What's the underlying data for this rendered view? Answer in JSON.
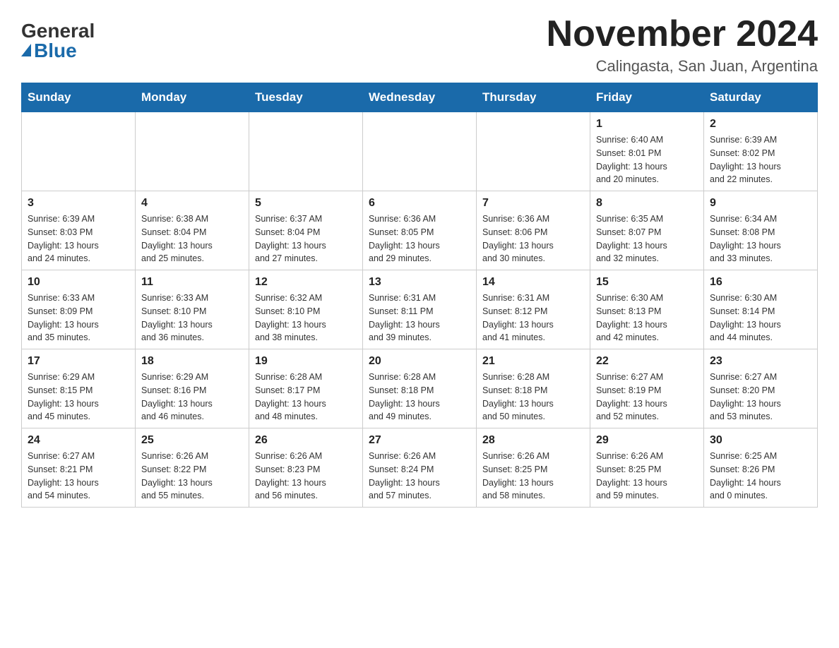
{
  "logo": {
    "general": "General",
    "blue": "Blue"
  },
  "title": "November 2024",
  "subtitle": "Calingasta, San Juan, Argentina",
  "days_of_week": [
    "Sunday",
    "Monday",
    "Tuesday",
    "Wednesday",
    "Thursday",
    "Friday",
    "Saturday"
  ],
  "weeks": [
    [
      {
        "day": "",
        "info": ""
      },
      {
        "day": "",
        "info": ""
      },
      {
        "day": "",
        "info": ""
      },
      {
        "day": "",
        "info": ""
      },
      {
        "day": "",
        "info": ""
      },
      {
        "day": "1",
        "info": "Sunrise: 6:40 AM\nSunset: 8:01 PM\nDaylight: 13 hours\nand 20 minutes."
      },
      {
        "day": "2",
        "info": "Sunrise: 6:39 AM\nSunset: 8:02 PM\nDaylight: 13 hours\nand 22 minutes."
      }
    ],
    [
      {
        "day": "3",
        "info": "Sunrise: 6:39 AM\nSunset: 8:03 PM\nDaylight: 13 hours\nand 24 minutes."
      },
      {
        "day": "4",
        "info": "Sunrise: 6:38 AM\nSunset: 8:04 PM\nDaylight: 13 hours\nand 25 minutes."
      },
      {
        "day": "5",
        "info": "Sunrise: 6:37 AM\nSunset: 8:04 PM\nDaylight: 13 hours\nand 27 minutes."
      },
      {
        "day": "6",
        "info": "Sunrise: 6:36 AM\nSunset: 8:05 PM\nDaylight: 13 hours\nand 29 minutes."
      },
      {
        "day": "7",
        "info": "Sunrise: 6:36 AM\nSunset: 8:06 PM\nDaylight: 13 hours\nand 30 minutes."
      },
      {
        "day": "8",
        "info": "Sunrise: 6:35 AM\nSunset: 8:07 PM\nDaylight: 13 hours\nand 32 minutes."
      },
      {
        "day": "9",
        "info": "Sunrise: 6:34 AM\nSunset: 8:08 PM\nDaylight: 13 hours\nand 33 minutes."
      }
    ],
    [
      {
        "day": "10",
        "info": "Sunrise: 6:33 AM\nSunset: 8:09 PM\nDaylight: 13 hours\nand 35 minutes."
      },
      {
        "day": "11",
        "info": "Sunrise: 6:33 AM\nSunset: 8:10 PM\nDaylight: 13 hours\nand 36 minutes."
      },
      {
        "day": "12",
        "info": "Sunrise: 6:32 AM\nSunset: 8:10 PM\nDaylight: 13 hours\nand 38 minutes."
      },
      {
        "day": "13",
        "info": "Sunrise: 6:31 AM\nSunset: 8:11 PM\nDaylight: 13 hours\nand 39 minutes."
      },
      {
        "day": "14",
        "info": "Sunrise: 6:31 AM\nSunset: 8:12 PM\nDaylight: 13 hours\nand 41 minutes."
      },
      {
        "day": "15",
        "info": "Sunrise: 6:30 AM\nSunset: 8:13 PM\nDaylight: 13 hours\nand 42 minutes."
      },
      {
        "day": "16",
        "info": "Sunrise: 6:30 AM\nSunset: 8:14 PM\nDaylight: 13 hours\nand 44 minutes."
      }
    ],
    [
      {
        "day": "17",
        "info": "Sunrise: 6:29 AM\nSunset: 8:15 PM\nDaylight: 13 hours\nand 45 minutes."
      },
      {
        "day": "18",
        "info": "Sunrise: 6:29 AM\nSunset: 8:16 PM\nDaylight: 13 hours\nand 46 minutes."
      },
      {
        "day": "19",
        "info": "Sunrise: 6:28 AM\nSunset: 8:17 PM\nDaylight: 13 hours\nand 48 minutes."
      },
      {
        "day": "20",
        "info": "Sunrise: 6:28 AM\nSunset: 8:18 PM\nDaylight: 13 hours\nand 49 minutes."
      },
      {
        "day": "21",
        "info": "Sunrise: 6:28 AM\nSunset: 8:18 PM\nDaylight: 13 hours\nand 50 minutes."
      },
      {
        "day": "22",
        "info": "Sunrise: 6:27 AM\nSunset: 8:19 PM\nDaylight: 13 hours\nand 52 minutes."
      },
      {
        "day": "23",
        "info": "Sunrise: 6:27 AM\nSunset: 8:20 PM\nDaylight: 13 hours\nand 53 minutes."
      }
    ],
    [
      {
        "day": "24",
        "info": "Sunrise: 6:27 AM\nSunset: 8:21 PM\nDaylight: 13 hours\nand 54 minutes."
      },
      {
        "day": "25",
        "info": "Sunrise: 6:26 AM\nSunset: 8:22 PM\nDaylight: 13 hours\nand 55 minutes."
      },
      {
        "day": "26",
        "info": "Sunrise: 6:26 AM\nSunset: 8:23 PM\nDaylight: 13 hours\nand 56 minutes."
      },
      {
        "day": "27",
        "info": "Sunrise: 6:26 AM\nSunset: 8:24 PM\nDaylight: 13 hours\nand 57 minutes."
      },
      {
        "day": "28",
        "info": "Sunrise: 6:26 AM\nSunset: 8:25 PM\nDaylight: 13 hours\nand 58 minutes."
      },
      {
        "day": "29",
        "info": "Sunrise: 6:26 AM\nSunset: 8:25 PM\nDaylight: 13 hours\nand 59 minutes."
      },
      {
        "day": "30",
        "info": "Sunrise: 6:25 AM\nSunset: 8:26 PM\nDaylight: 14 hours\nand 0 minutes."
      }
    ]
  ]
}
